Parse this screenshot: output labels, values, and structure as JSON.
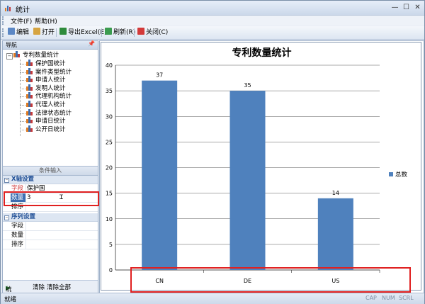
{
  "window": {
    "title": "统计",
    "controls": [
      "—",
      "☐",
      "✕"
    ]
  },
  "menu": {
    "items": [
      "文件(F)",
      "帮助(H)"
    ]
  },
  "toolbar": {
    "edit": "编辑",
    "open": "打开",
    "export": "导出Excel(E)",
    "refresh": "刷新(R)",
    "close": "关闭(C)"
  },
  "nav": {
    "title": "导航",
    "root": "专利数量统计",
    "items": [
      "保护国统计",
      "案件类型统计",
      "申请人统计",
      "发明人统计",
      "代理机构统计",
      "代理人统计",
      "法律状态统计",
      "申请日统计",
      "公开日统计"
    ]
  },
  "condition": {
    "title": "条件输入",
    "x_group": "X轴设置",
    "x_props": [
      {
        "key": "字段",
        "value": "保护国"
      },
      {
        "key": "数量",
        "value": "3"
      },
      {
        "key": "排序",
        "value": ""
      }
    ],
    "series_group": "序列设置",
    "series_props": [
      {
        "key": "字段",
        "value": ""
      },
      {
        "key": "数量",
        "value": ""
      },
      {
        "key": "排序",
        "value": ""
      }
    ]
  },
  "actions": {
    "stat": "统计",
    "clear": "清除",
    "clear_all": "清除全部"
  },
  "status": {
    "left": "就绪",
    "caps": "CAP",
    "num": "NUM",
    "scrl": "SCRL"
  },
  "colors": {
    "bar": "#4f81bd",
    "annotation": "#e02020"
  },
  "chart_data": {
    "type": "bar",
    "title": "专利数量统计",
    "categories": [
      "CN",
      "DE",
      "US"
    ],
    "series": [
      {
        "name": "总数",
        "values": [
          37,
          35,
          14
        ]
      }
    ],
    "ylim": [
      0,
      40
    ],
    "yticks": [
      0,
      5,
      10,
      15,
      20,
      25,
      30,
      35,
      40
    ],
    "grid": true,
    "legend": "right"
  }
}
